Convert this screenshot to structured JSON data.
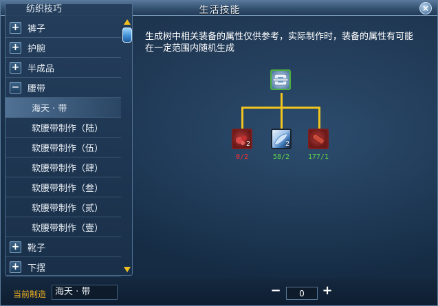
{
  "window": {
    "title": "生活技能",
    "close_label": "×"
  },
  "left": {
    "header": "纺织技巧",
    "list": [
      {
        "type": "category",
        "label": "裤子",
        "toggle": "+"
      },
      {
        "type": "category",
        "label": "护腕",
        "toggle": "+"
      },
      {
        "type": "category",
        "label": "半成品",
        "toggle": "+"
      },
      {
        "type": "category",
        "label": "腰带",
        "toggle": "−"
      },
      {
        "type": "item",
        "label": "海天 · 带",
        "selected": true
      },
      {
        "type": "item",
        "label": "软腰带制作（陆）"
      },
      {
        "type": "item",
        "label": "软腰带制作（伍）"
      },
      {
        "type": "item",
        "label": "软腰带制作（肆）"
      },
      {
        "type": "item",
        "label": "软腰带制作（叁）"
      },
      {
        "type": "item",
        "label": "软腰带制作（贰）"
      },
      {
        "type": "item",
        "label": "软腰带制作（壹）"
      },
      {
        "type": "category",
        "label": "靴子",
        "toggle": "+"
      },
      {
        "type": "category",
        "label": "下摆",
        "toggle": "+"
      }
    ]
  },
  "main": {
    "notice": "生成树中相关装备的属性仅供参考，实际制作时，装备的属性有可能在一定范围内随机生成",
    "materials": [
      {
        "icon": "red-ore-icon",
        "count": "2",
        "qty": "0/2",
        "qty_color": "#ff3030"
      },
      {
        "icon": "blue-feather-icon",
        "count": "2",
        "qty": "58/2",
        "qty_color": "#5cd14a"
      },
      {
        "icon": "red-log-icon",
        "count": "",
        "qty": "177/1",
        "qty_color": "#5cd14a"
      }
    ],
    "product_icon": "armor-belt-icon"
  },
  "bottom": {
    "craft_label": "当前制造",
    "craft_value": "海天 · 带",
    "minus": "−",
    "quantity": "0",
    "plus": "+"
  }
}
